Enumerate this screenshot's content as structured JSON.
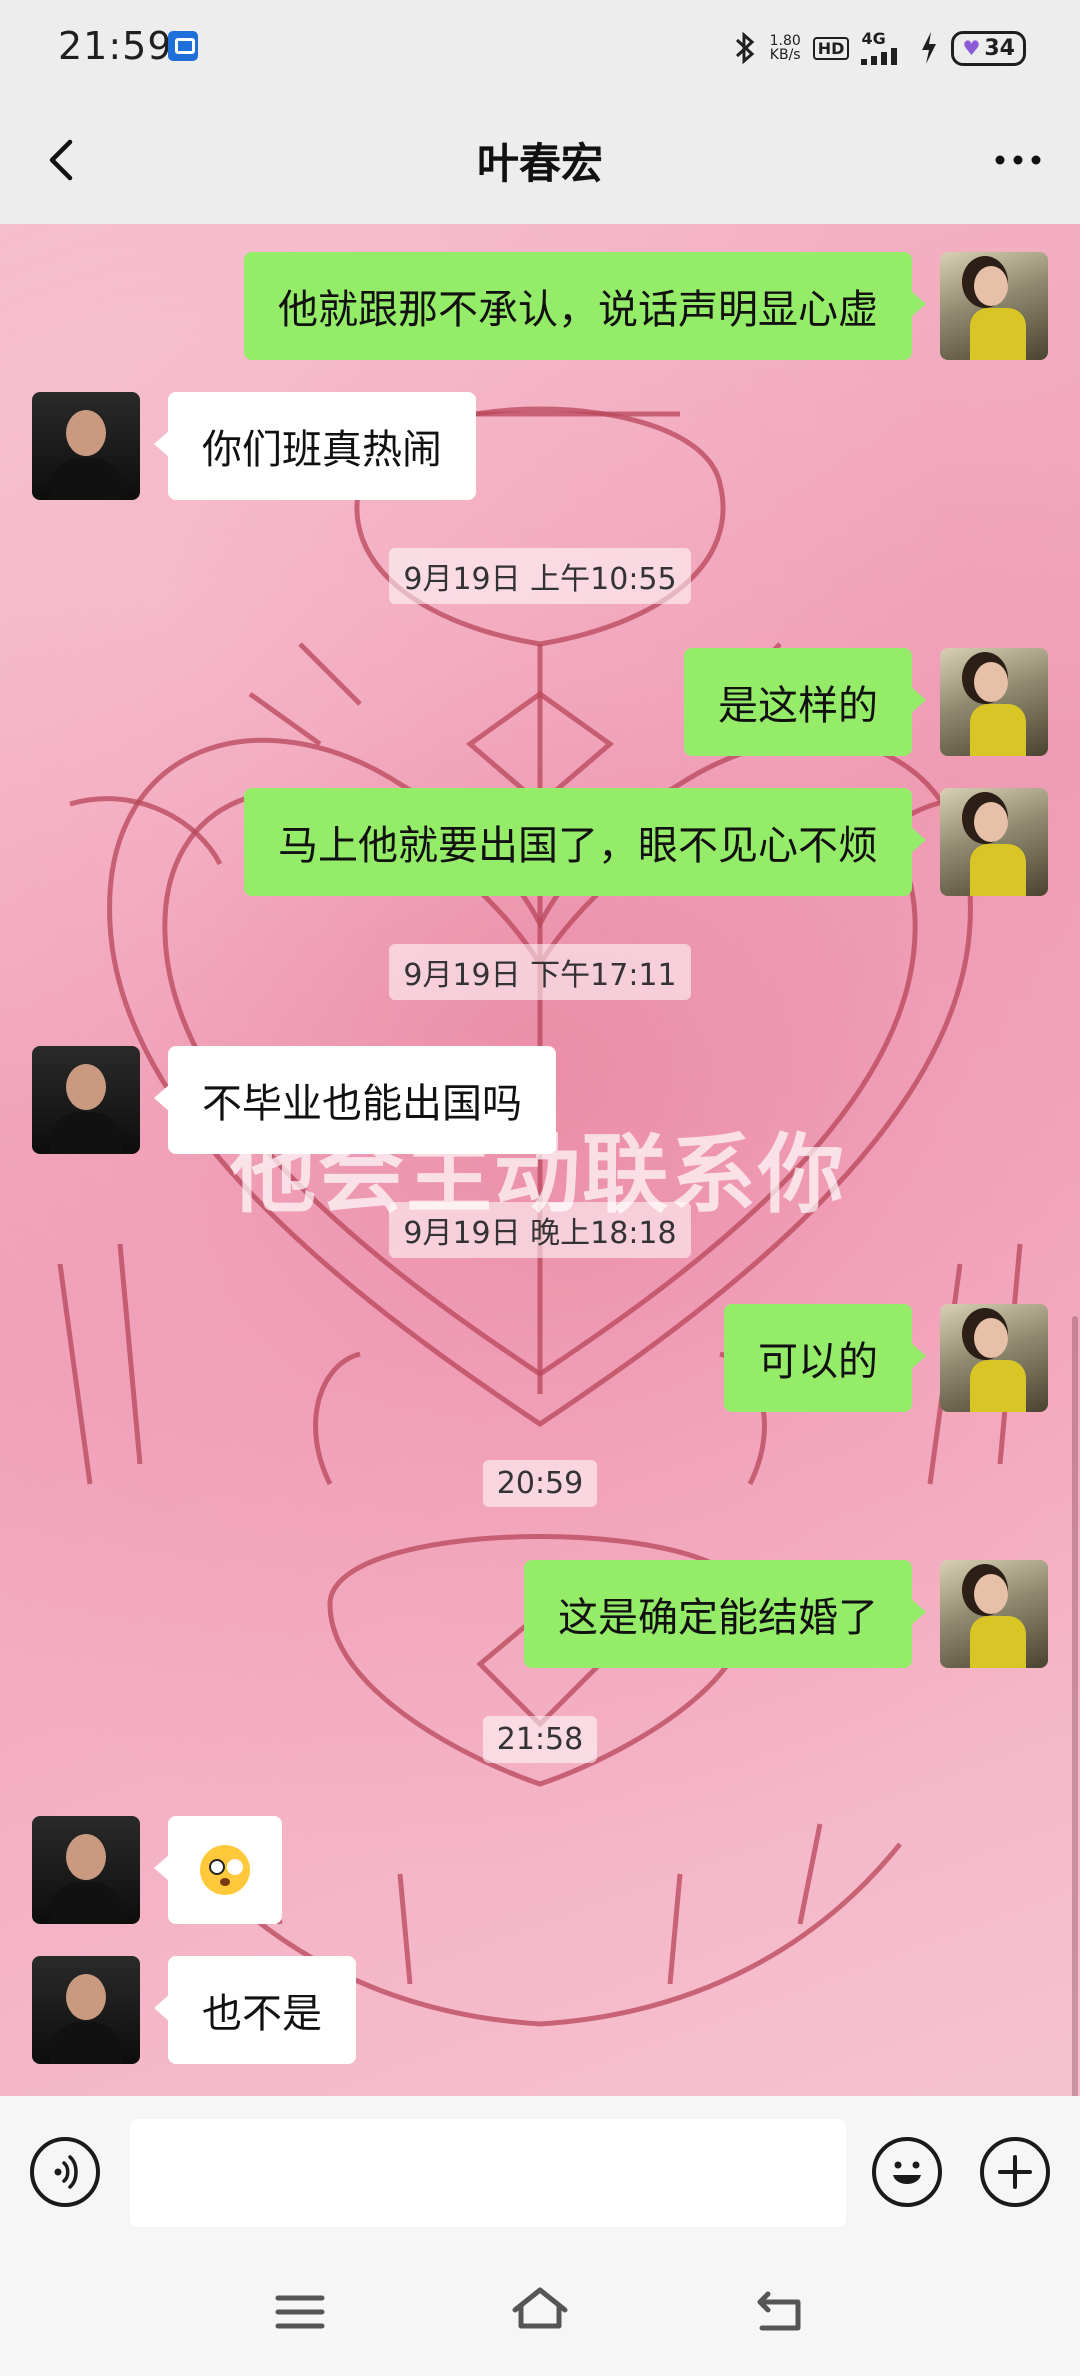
{
  "status_bar": {
    "time": "21:59",
    "net_speed_value": "1.80",
    "net_speed_unit": "KB/s",
    "hd": "HD",
    "network": "4G",
    "battery": "34",
    "icons": [
      "bluetooth-icon",
      "hd-icon",
      "signal-icon",
      "charging-icon",
      "battery-icon"
    ]
  },
  "header": {
    "title": "叶春宏",
    "back_icon": "chevron-left-icon",
    "more_icon": "more-dots-icon"
  },
  "background": {
    "watermark": "他会主动联系你"
  },
  "messages": [
    {
      "type": "out",
      "text": "他就跟那不承认，说话声明显心虚"
    },
    {
      "type": "in",
      "text": "你们班真热闹"
    },
    {
      "type": "time",
      "text": "9月19日 上午10:55"
    },
    {
      "type": "out",
      "text": "是这样的"
    },
    {
      "type": "out",
      "text": "马上他就要出国了，眼不见心不烦"
    },
    {
      "type": "time",
      "text": "9月19日 下午17:11"
    },
    {
      "type": "in",
      "text": "不毕业也能出国吗"
    },
    {
      "type": "time",
      "text": "9月19日 晚上18:18"
    },
    {
      "type": "out",
      "text": "可以的"
    },
    {
      "type": "time",
      "text": "20:59"
    },
    {
      "type": "out",
      "text": "这是确定能结婚了"
    },
    {
      "type": "time",
      "text": "21:58"
    },
    {
      "type": "in",
      "emoji": "flushed-emoji"
    },
    {
      "type": "in",
      "text": "也不是"
    }
  ],
  "input_bar": {
    "voice_icon": "voice-icon",
    "input_value": "",
    "emoji_icon": "smiley-icon",
    "plus_icon": "plus-icon"
  },
  "nav_bar": {
    "icons": [
      "menu-icon",
      "home-icon",
      "back-icon"
    ]
  },
  "colors": {
    "outgoing_bubble": "#95ec69",
    "incoming_bubble": "#ffffff",
    "chrome": "#ededed"
  }
}
